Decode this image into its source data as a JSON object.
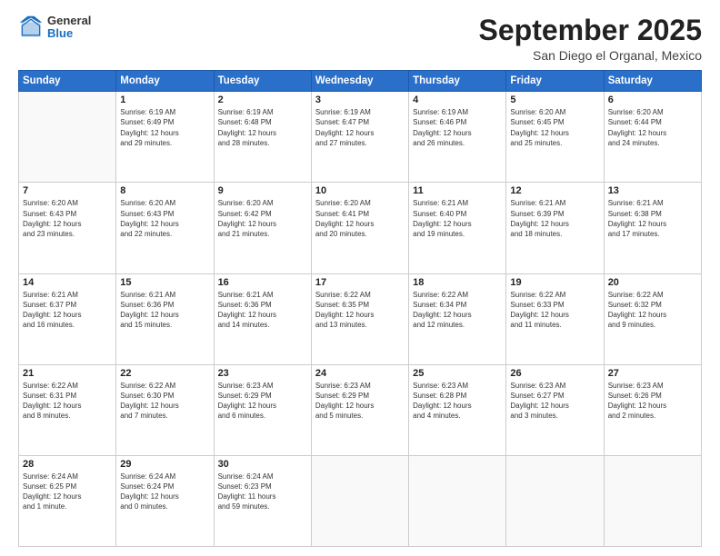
{
  "logo": {
    "general": "General",
    "blue": "Blue"
  },
  "header": {
    "month": "September 2025",
    "location": "San Diego el Organal, Mexico"
  },
  "weekdays": [
    "Sunday",
    "Monday",
    "Tuesday",
    "Wednesday",
    "Thursday",
    "Friday",
    "Saturday"
  ],
  "weeks": [
    [
      {
        "day": "",
        "info": ""
      },
      {
        "day": "1",
        "info": "Sunrise: 6:19 AM\nSunset: 6:49 PM\nDaylight: 12 hours\nand 29 minutes."
      },
      {
        "day": "2",
        "info": "Sunrise: 6:19 AM\nSunset: 6:48 PM\nDaylight: 12 hours\nand 28 minutes."
      },
      {
        "day": "3",
        "info": "Sunrise: 6:19 AM\nSunset: 6:47 PM\nDaylight: 12 hours\nand 27 minutes."
      },
      {
        "day": "4",
        "info": "Sunrise: 6:19 AM\nSunset: 6:46 PM\nDaylight: 12 hours\nand 26 minutes."
      },
      {
        "day": "5",
        "info": "Sunrise: 6:20 AM\nSunset: 6:45 PM\nDaylight: 12 hours\nand 25 minutes."
      },
      {
        "day": "6",
        "info": "Sunrise: 6:20 AM\nSunset: 6:44 PM\nDaylight: 12 hours\nand 24 minutes."
      }
    ],
    [
      {
        "day": "7",
        "info": "Sunrise: 6:20 AM\nSunset: 6:43 PM\nDaylight: 12 hours\nand 23 minutes."
      },
      {
        "day": "8",
        "info": "Sunrise: 6:20 AM\nSunset: 6:43 PM\nDaylight: 12 hours\nand 22 minutes."
      },
      {
        "day": "9",
        "info": "Sunrise: 6:20 AM\nSunset: 6:42 PM\nDaylight: 12 hours\nand 21 minutes."
      },
      {
        "day": "10",
        "info": "Sunrise: 6:20 AM\nSunset: 6:41 PM\nDaylight: 12 hours\nand 20 minutes."
      },
      {
        "day": "11",
        "info": "Sunrise: 6:21 AM\nSunset: 6:40 PM\nDaylight: 12 hours\nand 19 minutes."
      },
      {
        "day": "12",
        "info": "Sunrise: 6:21 AM\nSunset: 6:39 PM\nDaylight: 12 hours\nand 18 minutes."
      },
      {
        "day": "13",
        "info": "Sunrise: 6:21 AM\nSunset: 6:38 PM\nDaylight: 12 hours\nand 17 minutes."
      }
    ],
    [
      {
        "day": "14",
        "info": "Sunrise: 6:21 AM\nSunset: 6:37 PM\nDaylight: 12 hours\nand 16 minutes."
      },
      {
        "day": "15",
        "info": "Sunrise: 6:21 AM\nSunset: 6:36 PM\nDaylight: 12 hours\nand 15 minutes."
      },
      {
        "day": "16",
        "info": "Sunrise: 6:21 AM\nSunset: 6:36 PM\nDaylight: 12 hours\nand 14 minutes."
      },
      {
        "day": "17",
        "info": "Sunrise: 6:22 AM\nSunset: 6:35 PM\nDaylight: 12 hours\nand 13 minutes."
      },
      {
        "day": "18",
        "info": "Sunrise: 6:22 AM\nSunset: 6:34 PM\nDaylight: 12 hours\nand 12 minutes."
      },
      {
        "day": "19",
        "info": "Sunrise: 6:22 AM\nSunset: 6:33 PM\nDaylight: 12 hours\nand 11 minutes."
      },
      {
        "day": "20",
        "info": "Sunrise: 6:22 AM\nSunset: 6:32 PM\nDaylight: 12 hours\nand 9 minutes."
      }
    ],
    [
      {
        "day": "21",
        "info": "Sunrise: 6:22 AM\nSunset: 6:31 PM\nDaylight: 12 hours\nand 8 minutes."
      },
      {
        "day": "22",
        "info": "Sunrise: 6:22 AM\nSunset: 6:30 PM\nDaylight: 12 hours\nand 7 minutes."
      },
      {
        "day": "23",
        "info": "Sunrise: 6:23 AM\nSunset: 6:29 PM\nDaylight: 12 hours\nand 6 minutes."
      },
      {
        "day": "24",
        "info": "Sunrise: 6:23 AM\nSunset: 6:29 PM\nDaylight: 12 hours\nand 5 minutes."
      },
      {
        "day": "25",
        "info": "Sunrise: 6:23 AM\nSunset: 6:28 PM\nDaylight: 12 hours\nand 4 minutes."
      },
      {
        "day": "26",
        "info": "Sunrise: 6:23 AM\nSunset: 6:27 PM\nDaylight: 12 hours\nand 3 minutes."
      },
      {
        "day": "27",
        "info": "Sunrise: 6:23 AM\nSunset: 6:26 PM\nDaylight: 12 hours\nand 2 minutes."
      }
    ],
    [
      {
        "day": "28",
        "info": "Sunrise: 6:24 AM\nSunset: 6:25 PM\nDaylight: 12 hours\nand 1 minute."
      },
      {
        "day": "29",
        "info": "Sunrise: 6:24 AM\nSunset: 6:24 PM\nDaylight: 12 hours\nand 0 minutes."
      },
      {
        "day": "30",
        "info": "Sunrise: 6:24 AM\nSunset: 6:23 PM\nDaylight: 11 hours\nand 59 minutes."
      },
      {
        "day": "",
        "info": ""
      },
      {
        "day": "",
        "info": ""
      },
      {
        "day": "",
        "info": ""
      },
      {
        "day": "",
        "info": ""
      }
    ]
  ]
}
